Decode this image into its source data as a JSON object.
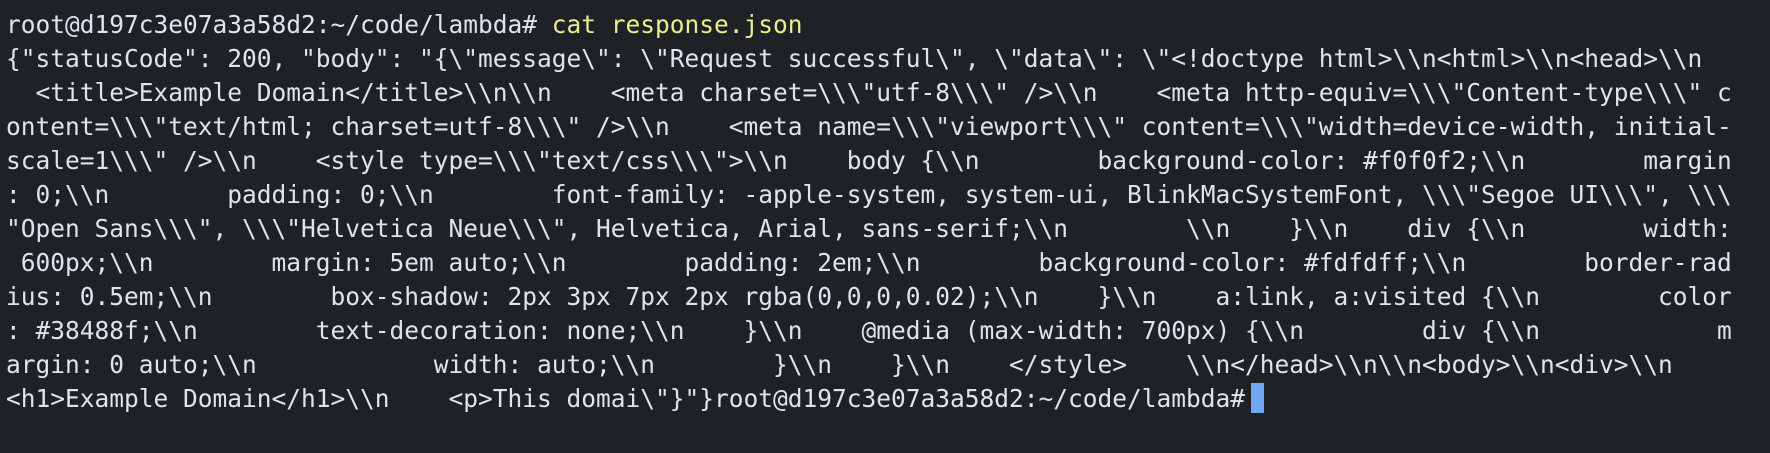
{
  "terminal": {
    "prompt": "root@d197c3e07a3a58d2:~/code/lambda#",
    "command": "cat response.json",
    "colors": {
      "background": "#1e2227",
      "text": "#dfe3ea",
      "command": "#ecec8a",
      "cursor": "#6ea8f0"
    },
    "output_lines": [
      "{\"statusCode\": 200, \"body\": \"{\\\"message\\\": \\\"Request successful\\\", \\\"data\\\": \\\"<!doctype html>\\\\n<html>\\\\n<head>\\\\n",
      "  <title>Example Domain</title>\\\\n\\\\n    <meta charset=\\\\\\\"utf-8\\\\\\\" />\\\\n    <meta http-equiv=\\\\\\\"Content-type\\\\\\\" c",
      "ontent=\\\\\\\"text/html; charset=utf-8\\\\\\\" />\\\\n    <meta name=\\\\\\\"viewport\\\\\\\" content=\\\\\\\"width=device-width, initial-",
      "scale=1\\\\\\\" />\\\\n    <style type=\\\\\\\"text/css\\\\\\\">\\\\n    body {\\\\n        background-color: #f0f0f2;\\\\n        margin",
      ": 0;\\\\n        padding: 0;\\\\n        font-family: -apple-system, system-ui, BlinkMacSystemFont, \\\\\\\"Segoe UI\\\\\\\", \\\\\\",
      "\"Open Sans\\\\\\\", \\\\\\\"Helvetica Neue\\\\\\\", Helvetica, Arial, sans-serif;\\\\n        \\\\n    }\\\\n    div {\\\\n        width:",
      " 600px;\\\\n        margin: 5em auto;\\\\n        padding: 2em;\\\\n        background-color: #fdfdff;\\\\n        border-rad",
      "ius: 0.5em;\\\\n        box-shadow: 2px 3px 7px 2px rgba(0,0,0,0.02);\\\\n    }\\\\n    a:link, a:visited {\\\\n        color",
      ": #38488f;\\\\n        text-decoration: none;\\\\n    }\\\\n    @media (max-width: 700px) {\\\\n        div {\\\\n            m",
      "argin: 0 auto;\\\\n            width: auto;\\\\n        }\\\\n    }\\\\n    </style>    \\\\n</head>\\\\n\\\\n<body>\\\\n<div>\\\\n"
    ],
    "last_output": "<h1>Example Domain</h1>\\\\n    <p>This domai\\\"}\"}"
  }
}
